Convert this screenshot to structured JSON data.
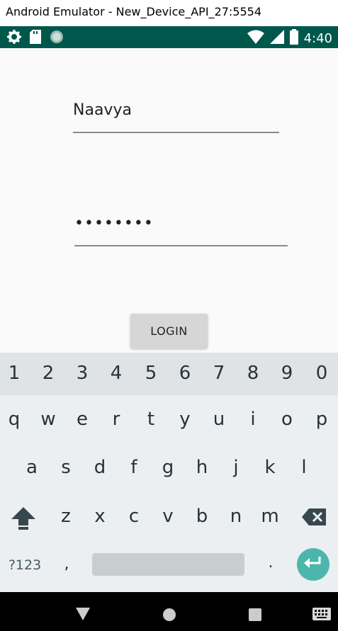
{
  "window": {
    "title": "Android Emulator - New_Device_API_27:5554"
  },
  "status": {
    "time": "4:40"
  },
  "form": {
    "username_value": "Naavya",
    "password_value": "••••••••",
    "login_label": "LOGIN"
  },
  "keyboard": {
    "numbers": [
      "1",
      "2",
      "3",
      "4",
      "5",
      "6",
      "7",
      "8",
      "9",
      "0"
    ],
    "row1": [
      "q",
      "w",
      "e",
      "r",
      "t",
      "y",
      "u",
      "i",
      "o",
      "p"
    ],
    "row2": [
      "a",
      "s",
      "d",
      "f",
      "g",
      "h",
      "j",
      "k",
      "l"
    ],
    "row3": [
      "z",
      "x",
      "c",
      "v",
      "b",
      "n",
      "m"
    ],
    "symbols_label": "?123",
    "comma_label": ",",
    "period_label": "."
  },
  "colors": {
    "status_bar": "#00574b",
    "enter_key": "#4db6ac"
  }
}
